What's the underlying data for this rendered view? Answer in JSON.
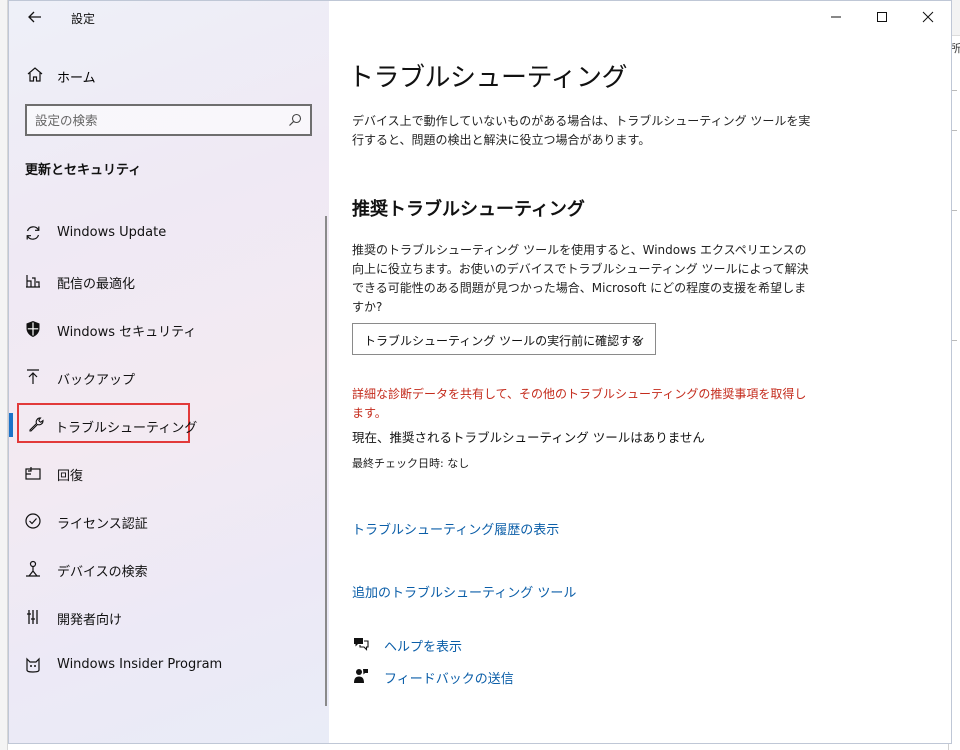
{
  "window": {
    "app_title": "設定",
    "controls": {
      "minimize": "—",
      "maximize": "☐",
      "close": "✕"
    }
  },
  "sidebar": {
    "home_label": "ホーム",
    "search_placeholder": "設定の検索",
    "section_title": "更新とセキュリティ",
    "items": [
      {
        "label": "Windows Update",
        "icon": "sync-icon"
      },
      {
        "label": "配信の最適化",
        "icon": "delivery-optimization-icon"
      },
      {
        "label": "Windows セキュリティ",
        "icon": "shield-icon"
      },
      {
        "label": "バックアップ",
        "icon": "backup-arrow-icon"
      },
      {
        "label": "トラブルシューティング",
        "icon": "wrench-icon",
        "selected": true
      },
      {
        "label": "回復",
        "icon": "recovery-icon"
      },
      {
        "label": "ライセンス認証",
        "icon": "check-circle-icon"
      },
      {
        "label": "デバイスの検索",
        "icon": "person-location-icon"
      },
      {
        "label": "開発者向け",
        "icon": "developer-tools-icon"
      },
      {
        "label": "Windows Insider Program",
        "icon": "insider-cat-icon"
      }
    ],
    "accent_color": "#1a73c8",
    "highlight_color": "#e23a3a"
  },
  "content": {
    "title": "トラブルシューティング",
    "intro": "デバイス上で動作していないものがある場合は、トラブルシューティング ツールを実行すると、問題の検出と解決に役立つ場合があります。",
    "recommended_title": "推奨トラブルシューティング",
    "recommended_desc": "推奨のトラブルシューティング ツールを使用すると、Windows エクスペリエンスの向上に役立ちます。お使いのデバイスでトラブルシューティング ツールによって解決できる可能性のある問題が見つかった場合、Microsoft にどの程度の支援を希望しますか?",
    "dropdown_value": "トラブルシューティング ツールの実行前に確認する",
    "diagnostic_link": "詳細な診断データを共有して、その他のトラブルシューティングの推奨事項を取得します。",
    "status": "現在、推奨されるトラブルシューティング ツールはありません",
    "last_check": "最終チェック日時: なし",
    "history_link": "トラブルシューティング履歴の表示",
    "additional_link": "追加のトラブルシューティング ツール",
    "help_label": "ヘルプを表示",
    "feedback_label": "フィードバックの送信",
    "link_color": "#0b5ea8",
    "warning_color": "#c42b1c"
  },
  "background_app": {
    "tab_text": "所"
  }
}
